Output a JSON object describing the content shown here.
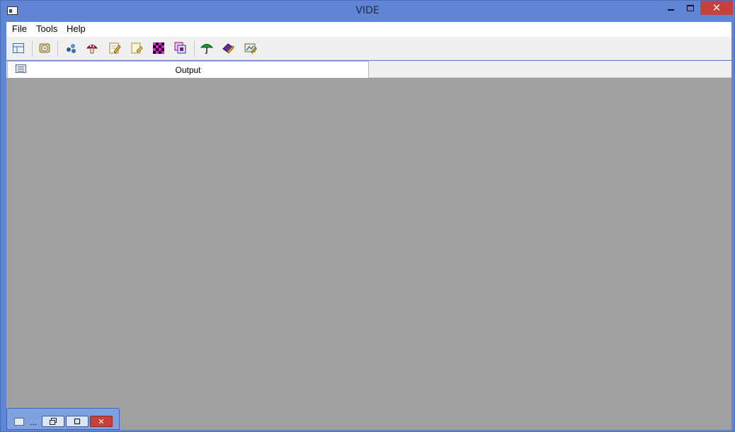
{
  "window": {
    "title": "VIDE",
    "close_glyph": "✕"
  },
  "menu": {
    "items": [
      "File",
      "Tools",
      "Help"
    ]
  },
  "toolbar": {
    "icons": [
      "layout-grid-icon",
      "disk-magnifier-icon",
      "blue-dots-icon",
      "red-mushroom-icon",
      "edit-document-icon",
      "document-arrow-icon",
      "magenta-checker-icon",
      "overlapping-windows-icon",
      "green-umbrella-icon",
      "purple-eraser-icon",
      "image-settings-icon"
    ]
  },
  "tabs": [
    {
      "label": "Output"
    }
  ],
  "minimized_window": {
    "label": "...",
    "close_glyph": "✕"
  },
  "colors": {
    "title_bar": "#5f85d3",
    "workspace": "#a0a0a0",
    "close_button": "#c8403a"
  }
}
